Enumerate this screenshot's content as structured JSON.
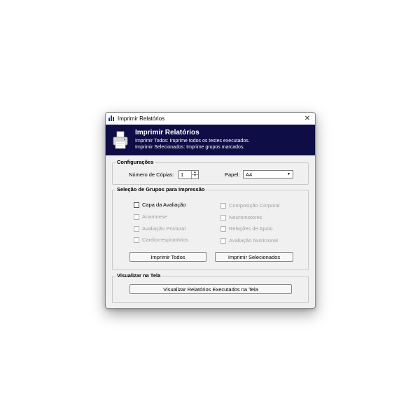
{
  "window": {
    "title": "Imprimir Relatórios",
    "close": "✕"
  },
  "banner": {
    "title": "Imprimir Relatórios",
    "line1": "Imprimir Todos: Imprime todos os testes executados.",
    "line2": "Imprimir Selecionados: Imprime grupos marcados."
  },
  "config": {
    "label": "Configurações",
    "copies_label": "Número de Cópias:",
    "copies_value": "1",
    "paper_label": "Papel:",
    "paper_value": "A4"
  },
  "groups": {
    "label": "Seleção de Grupos para Impressão",
    "left": [
      {
        "label": "Capa da Avaliação",
        "enabled": true
      },
      {
        "label": "Anamnese",
        "enabled": false
      },
      {
        "label": "Avaliação Postural",
        "enabled": false
      },
      {
        "label": "Cardiorrespiratórios",
        "enabled": false
      }
    ],
    "right": [
      {
        "label": "Composição Corporal",
        "enabled": false
      },
      {
        "label": "Neuromotores",
        "enabled": false
      },
      {
        "label": "Relações de Apoio",
        "enabled": false
      },
      {
        "label": "Avaliação Nutricional",
        "enabled": false
      }
    ],
    "print_all": "Imprimir Todos",
    "print_selected": "Imprimir Selecionados"
  },
  "screen": {
    "label": "Visualizar na Tela",
    "button": "Visualizar Relatórios Executados na Tela"
  },
  "colors": {
    "banner": "#0e0d45",
    "window_bg": "#f0f0f0"
  }
}
